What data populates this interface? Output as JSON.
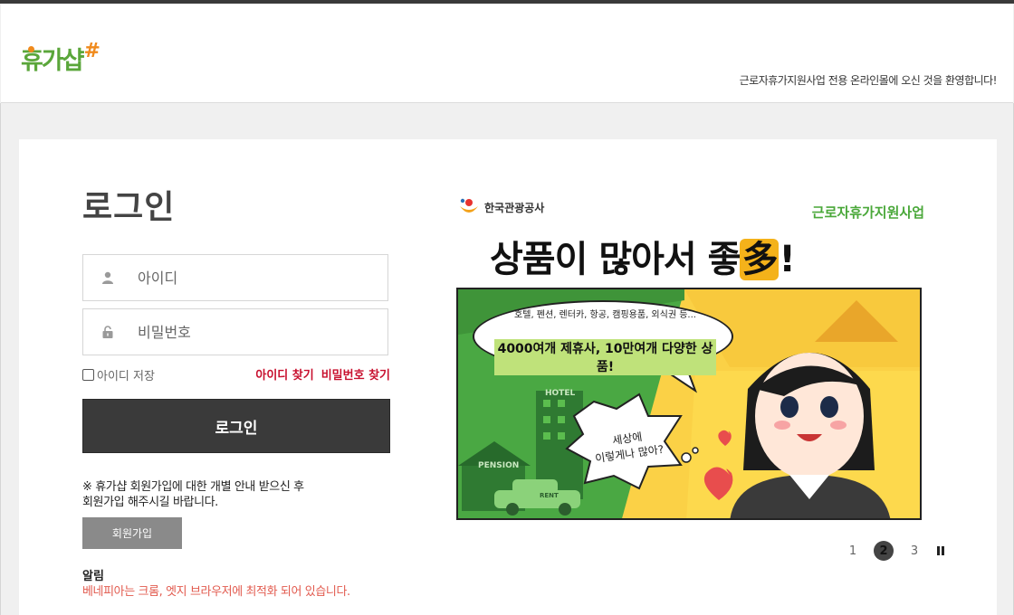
{
  "header": {
    "logo_text": "휴가샵",
    "logo_mark": "#",
    "welcome": "근로자휴가지원사업 전용 온라인몰에 오신 것을 환영합니다!"
  },
  "login": {
    "title": "로그인",
    "id_placeholder": "아이디",
    "pw_placeholder": "비밀번호",
    "save_id_label": "아이디 저장",
    "find_id": "아이디 찾기",
    "find_pw": "비밀번호 찾기",
    "submit_label": "로그인",
    "join_note_line1": "※ 휴가샵 회원가입에 대한 개별 안내 받으신 후",
    "join_note_line2": "회원가입 해주시길 바랍니다.",
    "join_button": "회원가입",
    "notice_title": "알림",
    "notice_text": "베네피아는 크롬, 엣지 브라우저에 최적화 되어 있습니다."
  },
  "banner": {
    "org": "한국관광공사",
    "program": "근로자휴가지원사업",
    "headline_part": "상품이 많아서 좋",
    "headline_highlight": "多",
    "headline_end": "!",
    "bubble_small": "호텔, 펜션, 렌터카, 항공, 캠핑용품, 외식권 등...",
    "bubble_main": "4000여개 제휴사, 10만여개 다양한 상품!",
    "thought_line1": "세상에",
    "thought_line2": "이렇게나 많아?",
    "sign_hotel": "HOTEL",
    "sign_pension": "PENSION",
    "sign_rent": "RENT"
  },
  "pager": {
    "pages": [
      "1",
      "2",
      "3"
    ],
    "active": "2"
  },
  "colors": {
    "brand_green": "#5aa63a",
    "brand_orange": "#f08a1c",
    "link_red": "#c8102e",
    "notice_red": "#e25b4f",
    "button_dark": "#3a3a3a"
  }
}
